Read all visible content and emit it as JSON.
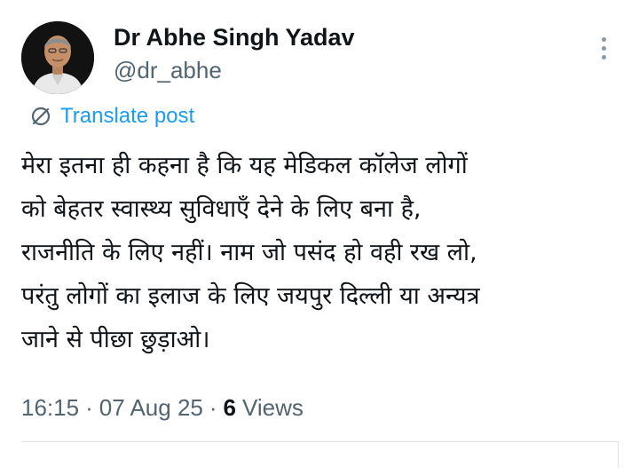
{
  "author": {
    "display_name": "Dr Abhe Singh Yadav",
    "handle": "@dr_abhe",
    "avatar_icon": "profile-photo"
  },
  "more_icon": "more-vertical-icon",
  "translate": {
    "icon": "translate-globe-icon",
    "label": "Translate post",
    "color": "#1d9bf0"
  },
  "post": {
    "lines": [
      "मेरा इतना ही कहना है कि यह मेडिकल कॉलेज लोगों",
      "को बेहतर स्वास्थ्य सुविधाएँ देने  के लिए बना है,",
      "राजनीति के लिए नहीं। नाम जो पसंद हो वही रख लो,",
      "परंतु लोगों का इलाज के लिए जयपुर दिल्ली या अन्यत्र",
      "जाने से पीछा छुड़ाओ।"
    ]
  },
  "meta": {
    "time": "16:15",
    "separator": "·",
    "date": "07 Aug 25",
    "views_count": "6",
    "views_label": "Views"
  },
  "colors": {
    "text_primary": "#0f1419",
    "text_secondary": "#536471",
    "link": "#1d9bf0"
  }
}
